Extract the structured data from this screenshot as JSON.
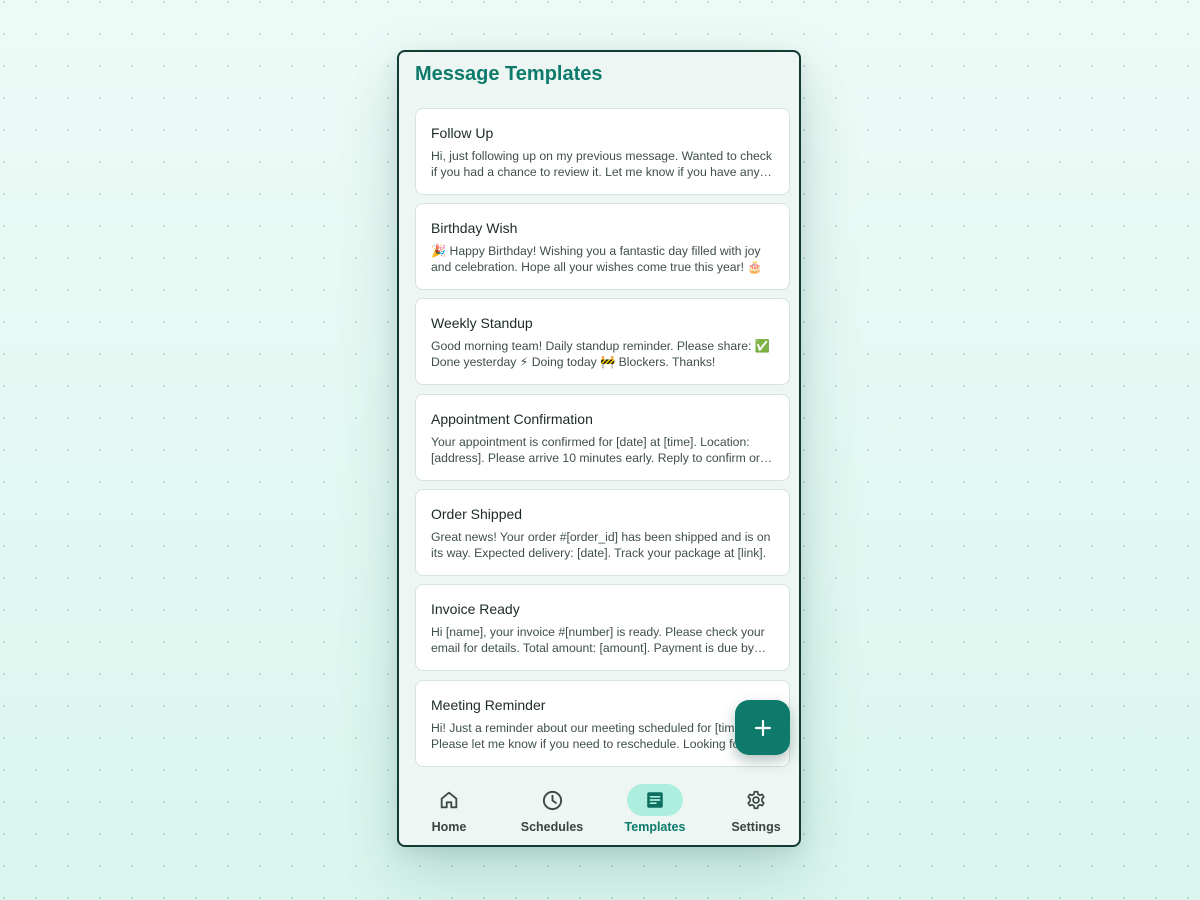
{
  "app": {
    "title": "Message Templates"
  },
  "templates": [
    {
      "title": "Follow Up",
      "body": "Hi, just following up on my previous message. Wanted to check if you had a chance to review it. Let me know if you have any questions."
    },
    {
      "title": "Birthday Wish",
      "body": "🎉 Happy Birthday! Wishing you a fantastic day filled with joy and celebration. Hope all your wishes come true this year! 🎂"
    },
    {
      "title": "Weekly Standup",
      "body": "Good morning team! Daily standup reminder. Please share: ✅ Done yesterday ⚡ Doing today 🚧 Blockers. Thanks!"
    },
    {
      "title": "Appointment Confirmation",
      "body": "Your appointment is confirmed for [date] at [time]. Location: [address]. Please arrive 10 minutes early. Reply to confirm or reschedule."
    },
    {
      "title": "Order Shipped",
      "body": "Great news! Your order #[order_id] has been shipped and is on its way. Expected delivery: [date]. Track your package at [link]."
    },
    {
      "title": "Invoice Ready",
      "body": "Hi [name], your invoice #[number] is ready. Please check your email for details. Total amount: [amount]. Payment is due by [date]."
    },
    {
      "title": "Meeting Reminder",
      "body": "Hi! Just a reminder about our meeting scheduled for [time]. Please let me know if you need to reschedule. Looking forward to it!"
    }
  ],
  "fab": {
    "icon": "plus-icon"
  },
  "nav": {
    "items": [
      {
        "label": "Home",
        "icon": "home-icon",
        "active": false
      },
      {
        "label": "Schedules",
        "icon": "clock-icon",
        "active": false
      },
      {
        "label": "Templates",
        "icon": "document-icon",
        "active": true
      },
      {
        "label": "Settings",
        "icon": "gear-icon",
        "active": false
      }
    ]
  },
  "colors": {
    "accent": "#0d7a6c",
    "active_pill": "#aeeede",
    "background": "#e6f8f3",
    "card": "#ffffff"
  }
}
